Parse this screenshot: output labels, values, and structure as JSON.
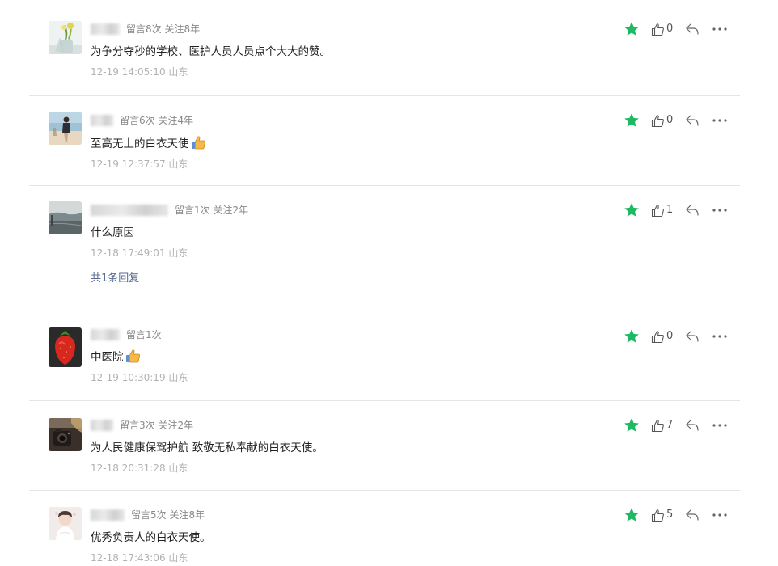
{
  "comments": [
    {
      "stats": "留言8次 关注8年",
      "text": "为争分夺秒的学校、医护人员人员点个大大的赞。",
      "emoji": "",
      "time": "12-19 14:05:10 山东",
      "likes": "0",
      "starred": true,
      "avatar": "avatar-flowers"
    },
    {
      "stats": "留言6次 关注4年",
      "text": "至高无上的白衣天使",
      "emoji": "thumbs-up",
      "time": "12-19 12:37:57 山东",
      "likes": "0",
      "starred": true,
      "avatar": "avatar-beach"
    },
    {
      "stats": "留言1次 关注2年",
      "text": "什么原因",
      "emoji": "",
      "time": "12-18 17:49:01 山东",
      "likes": "1",
      "starred": true,
      "avatar": "avatar-coast",
      "replies_label": "共1条回复"
    },
    {
      "stats": "留言1次",
      "text": "中医院",
      "emoji": "thumbs-up",
      "time": "12-19 10:30:19 山东",
      "likes": "0",
      "starred": true,
      "avatar": "avatar-strawberry"
    },
    {
      "stats": "留言3次 关注2年",
      "text": "为人民健康保驾护航 致敬无私奉献的白衣天使。",
      "emoji": "",
      "time": "12-18 20:31:28 山东",
      "likes": "7",
      "starred": true,
      "avatar": "avatar-camera"
    },
    {
      "stats": "留言5次 关注8年",
      "text": "优秀负责人的白衣天使。",
      "emoji": "",
      "time": "12-18 17:43:06 山东",
      "likes": "5",
      "starred": true,
      "avatar": "avatar-girl"
    }
  ],
  "colors": {
    "star": "#1fb964",
    "link": "#576b95",
    "divider": "#e5e5e5",
    "time": "#b2b2b2"
  }
}
